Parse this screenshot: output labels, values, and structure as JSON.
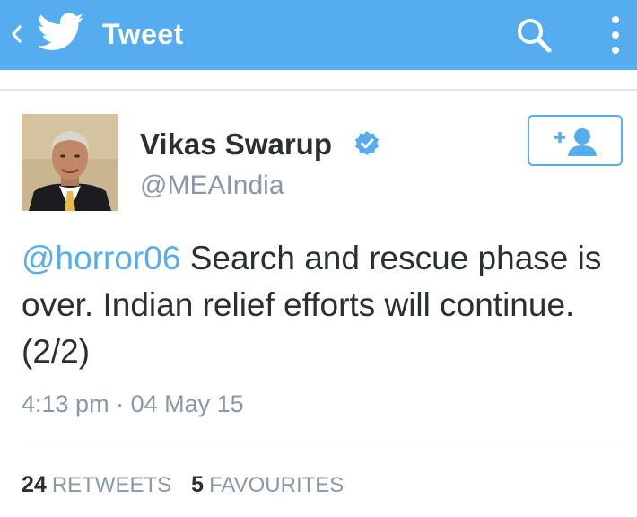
{
  "appbar": {
    "title": "Tweet",
    "color": "#55acee",
    "back_icon": "chevron-left-icon",
    "logo_icon": "twitter-bird-icon",
    "search_icon": "search-icon",
    "more_icon": "more-vertical-icon"
  },
  "tweet": {
    "author_name": "Vikas Swarup",
    "verified_icon": "verified-badge-icon",
    "handle": "@MEAIndia",
    "follow_icon": "follow-user-icon",
    "mention": "@horror06",
    "text": " Search and rescue phase is over. Indian relief efforts will continue. (2/2)",
    "time": "4:13 pm",
    "separator": " · ",
    "date": "04 May 15",
    "retweets_count": "24",
    "retweets_label": "Retweets",
    "favourites_count": "5",
    "favourites_label": "Favourites"
  }
}
